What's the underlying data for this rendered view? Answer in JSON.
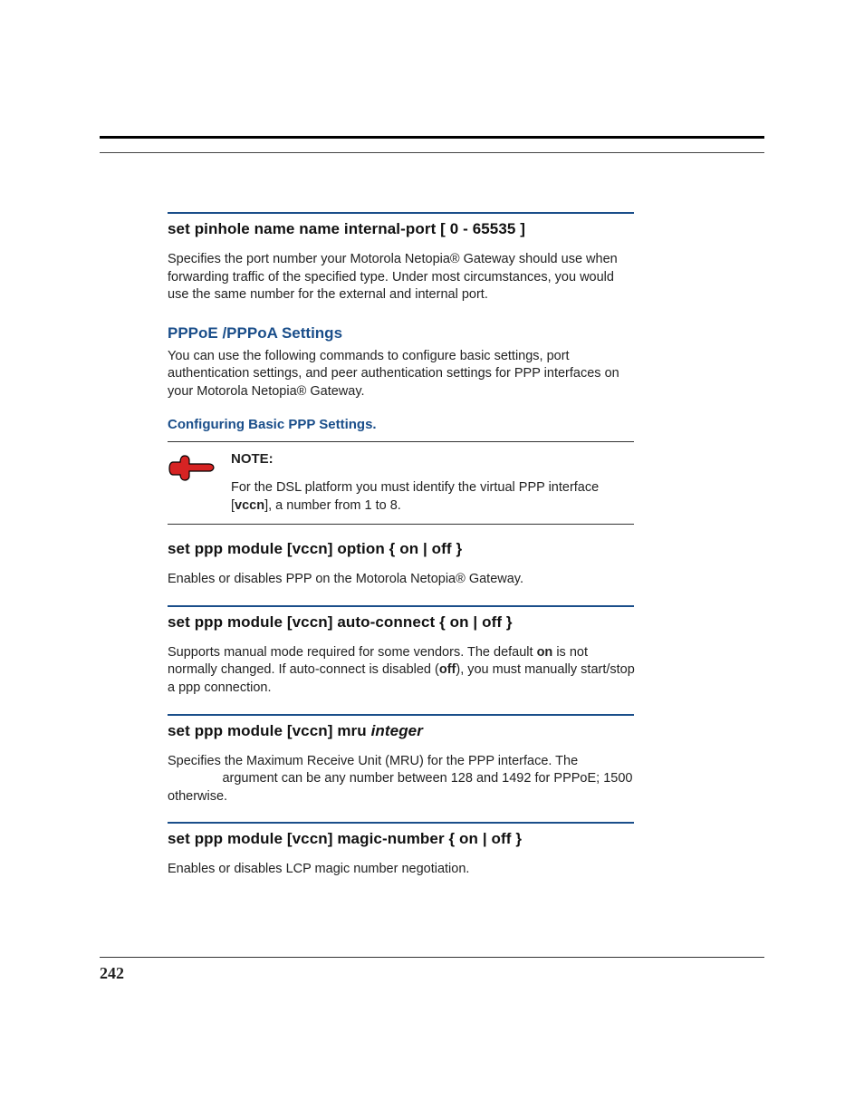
{
  "page_number": "242",
  "section1": {
    "heading": "set pinhole name name internal-port [ 0 - 65535 ]",
    "body": "Specifies the port number your Motorola Netopia® Gateway should use when forwarding traffic of the specified type. Under most circumstances, you would use the same number for the external and internal port."
  },
  "pppoe": {
    "title": "PPPoE /PPPoA Settings",
    "intro": "You can use the following commands to configure basic settings, port authentication settings, and peer authentication settings for PPP interfaces on your Motorola Netopia® Gateway.",
    "subhead": "Configuring Basic PPP Settings."
  },
  "note": {
    "label": "NOTE:",
    "body_pre": "For the DSL platform you must identify the virtual PPP interface [",
    "body_bold": "vccn",
    "body_post": "], a number from 1 to 8."
  },
  "cmd_option": {
    "heading": "set ppp module [vccn] option { on | off }",
    "body": "Enables or disables PPP on the Motorola Netopia® Gateway."
  },
  "cmd_auto": {
    "heading": "set ppp module [vccn] auto-connect { on | off }",
    "body_a": "Supports manual mode required for some vendors. The default ",
    "body_on": "on",
    "body_b": " is not normally changed. If auto-connect is disabled (",
    "body_off": "off",
    "body_c": "), you must manually start/stop a ppp connection."
  },
  "cmd_mru": {
    "heading_pre": "set ppp module [vccn] mru ",
    "heading_ital": "integer",
    "body_a": "Specifies the Maximum Receive Unit (MRU) for the PPP interface. The ",
    "body_gap": "               ",
    "body_b": "argument can be any number between 128 and 1492 for PPPoE; 1500 otherwise."
  },
  "cmd_magic": {
    "heading": "set ppp module [vccn] magic-number { on | off }",
    "body": "Enables or disables LCP magic number negotiation."
  }
}
